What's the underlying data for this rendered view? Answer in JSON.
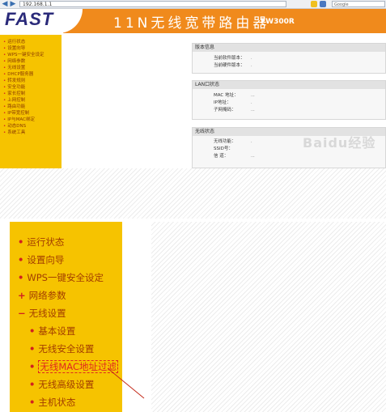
{
  "browser": {
    "address": "192.168.1.1",
    "search_placeholder": "Google"
  },
  "header": {
    "logo": "FAST",
    "title": "11N无线宽带路由器",
    "model": "FW300R"
  },
  "sidebar_small": {
    "items": [
      "运行状态",
      "设置向导",
      "WPS一键安全设定",
      "网络参数",
      "无线设置",
      "DHCP服务器",
      "转发规则",
      "安全功能",
      "家长控制",
      "上网控制",
      "路由功能",
      "IP带宽控制",
      "IP与MAC绑定",
      "动态DNS",
      "系统工具"
    ]
  },
  "panels": {
    "version": {
      "title": "版本信息",
      "rows": [
        {
          "label": "当前软件版本：",
          "value": "."
        },
        {
          "label": "当前硬件版本：",
          "value": "."
        }
      ]
    },
    "lan": {
      "title": "LAN口状态",
      "rows": [
        {
          "label": "MAC 地址：",
          "value": "..."
        },
        {
          "label": "IP地址：",
          "value": "."
        },
        {
          "label": "子网掩码：",
          "value": "..."
        }
      ]
    },
    "wireless": {
      "title": "无线状态",
      "rows": [
        {
          "label": "无线功能：",
          "value": "."
        },
        {
          "label": "SSID号：",
          "value": ""
        },
        {
          "label": "信 道：",
          "value": "..."
        }
      ]
    }
  },
  "watermark": "Baidu经验",
  "sidebar_zoom": {
    "items": [
      {
        "label": "运行状态",
        "bullet": "•"
      },
      {
        "label": "设置向导",
        "bullet": "•"
      },
      {
        "label": "WPS一键安全设定",
        "bullet": "•"
      },
      {
        "label": "网络参数",
        "bullet": "+"
      },
      {
        "label": "无线设置",
        "bullet": "−"
      },
      {
        "label": "基本设置",
        "bullet": "•"
      },
      {
        "label": "无线安全设置",
        "bullet": "•"
      },
      {
        "label": "无线MAC地址过滤",
        "bullet": "•"
      },
      {
        "label": "无线高级设置",
        "bullet": "•"
      },
      {
        "label": "主机状态",
        "bullet": "•"
      }
    ]
  },
  "colors": {
    "accent_orange": "#f08a1c",
    "sidebar_yellow": "#f6c300",
    "highlight_red": "#e0281e"
  }
}
